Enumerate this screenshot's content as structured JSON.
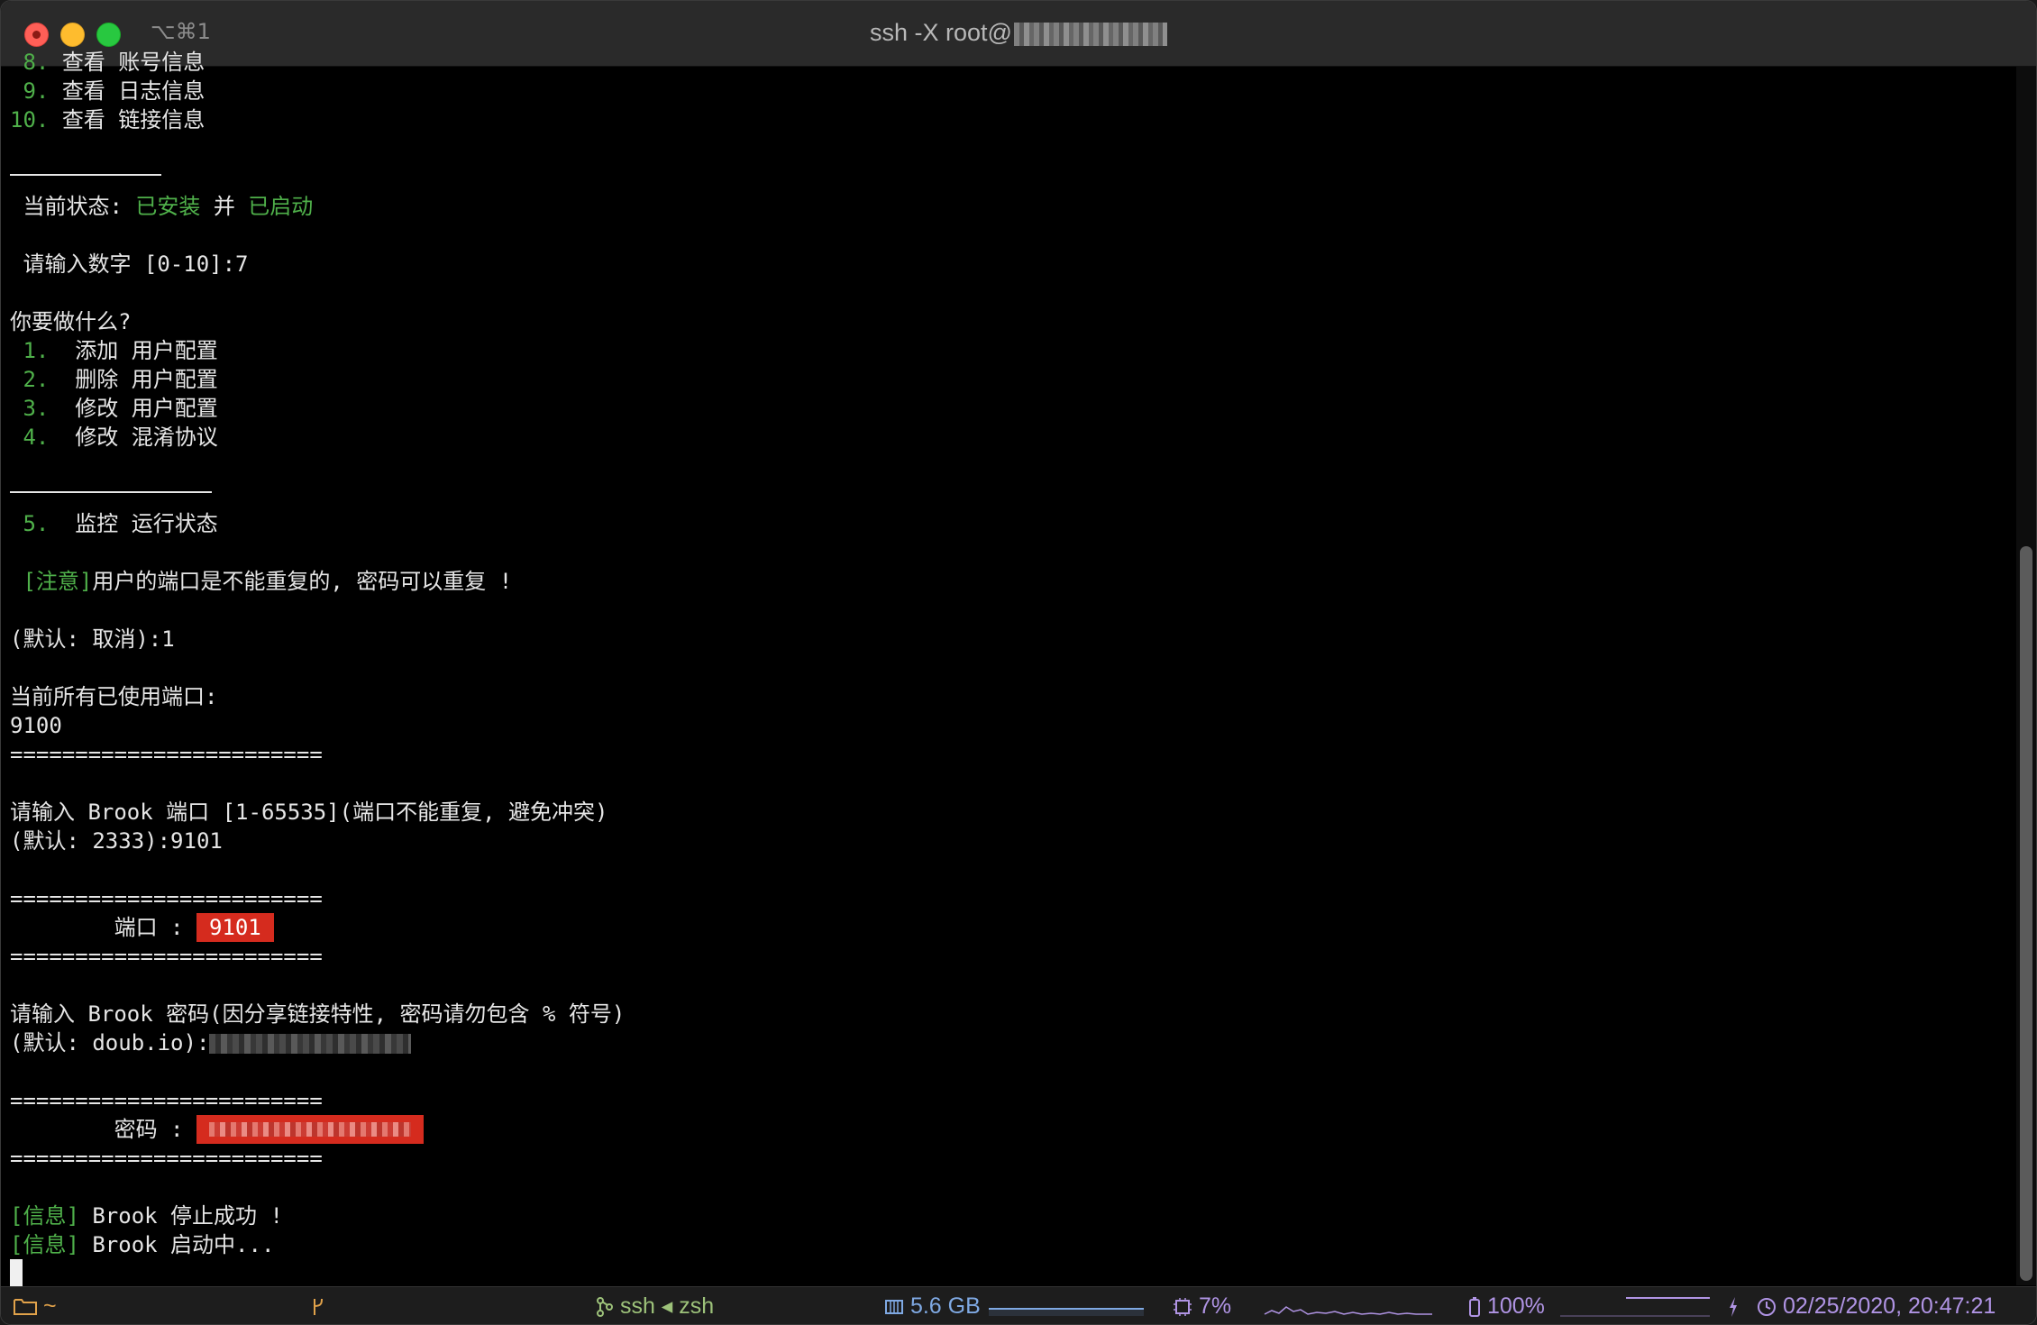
{
  "window": {
    "shortcut": "⌥⌘1",
    "title": "ssh -X root@"
  },
  "terminal": {
    "menu_top": [
      {
        "num": "8.",
        "text": "查看 账号信息"
      },
      {
        "num": "9.",
        "text": "查看 日志信息"
      },
      {
        "num": "10.",
        "text": "查看 链接信息"
      }
    ],
    "status_label": "当前状态:",
    "status_installed": "已安装",
    "status_and": "并",
    "status_started": "已启动",
    "prompt_number": "请输入数字 [0-10]:7",
    "question": "你要做什么?",
    "menu_actions": [
      {
        "num": "1.",
        "text": "添加 用户配置"
      },
      {
        "num": "2.",
        "text": "删除 用户配置"
      },
      {
        "num": "3.",
        "text": "修改 用户配置"
      },
      {
        "num": "4.",
        "text": "修改 混淆协议"
      }
    ],
    "menu_monitor": {
      "num": "5.",
      "text": "监控 运行状态"
    },
    "notice_tag": "[注意]",
    "notice_text": "用户的端口是不能重复的, 密码可以重复 !",
    "default_cancel": "(默认: 取消):1",
    "ports_label": "当前所有已使用端口:",
    "ports_value": "9100",
    "separator": "========================",
    "port_prompt": "请输入 Brook 端口 [1-65535](端口不能重复, 避免冲突)",
    "port_default": "(默认: 2333):9101",
    "port_label": "端口 :",
    "port_value": "9101",
    "pw_prompt": "请输入 Brook 密码(因分享链接特性, 密码请勿包含 % 符号)",
    "pw_default": "(默认: doub.io):",
    "pw_label": "密码 :",
    "info_tag": "[信息]",
    "info_stop": "Brook 停止成功 !",
    "info_start": "Brook 启动中..."
  },
  "statusbar": {
    "folder_icon": "folder-icon",
    "dir": "~",
    "git_icon": "git-branch-icon",
    "session": "ssh ◂ zsh",
    "memory": "5.6 GB",
    "cpu": "7%",
    "battery": "100%",
    "datetime": "02/25/2020, 20:47:21",
    "colors": {
      "orange": "#e1a24a",
      "green": "#9dc27a",
      "blue": "#7fa9e3",
      "purple": "#b094e4"
    }
  }
}
